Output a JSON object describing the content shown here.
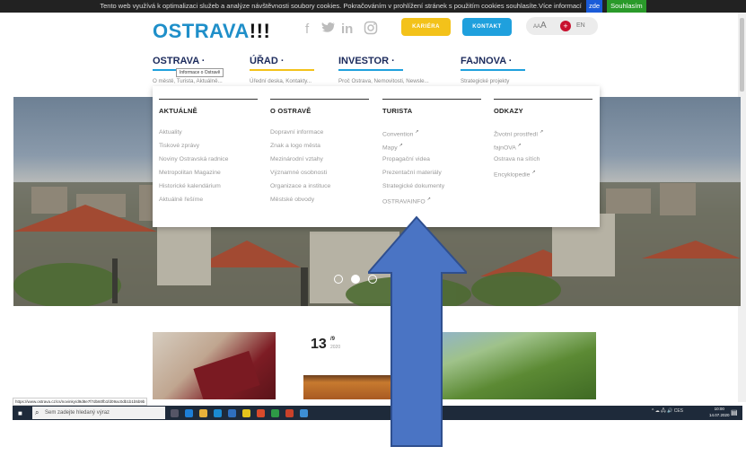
{
  "cookie_bar": {
    "text": "Tento web využívá k optimalizaci služeb a analýze návštěvnosti soubory cookies. Pokračováním v prohlížení stránek s použitím cookies souhlasíte.Více informací",
    "link": "zde",
    "accept": "Souhlasím"
  },
  "header": {
    "logo_main": "OSTRAVA",
    "logo_excl": "!!!",
    "social_icons": [
      "facebook-icon",
      "twitter-icon",
      "linkedin-icon",
      "instagram-icon"
    ],
    "kariera": "KARIÉRA",
    "kontakt": "KONTAKT",
    "font_size_switch": "AA",
    "font_size_small": "A",
    "language": "EN"
  },
  "nav": [
    {
      "title": "OSTRAVA",
      "sub": "O městě, Turista, Aktuálně...",
      "color": "#1fa0dd"
    },
    {
      "title": "ÚŘAD",
      "sub": "Úřední deska, Kontakty...",
      "color": "#f3c21a"
    },
    {
      "title": "INVESTOR",
      "sub": "Proč Ostrava, Nemovitosti, Newsle...",
      "color": "#1fa0dd"
    },
    {
      "title": "FAJNOVA",
      "sub": "Strategické projekty",
      "color": "#1fa0dd"
    }
  ],
  "tooltip": "Informace o Ostravě",
  "mega_menu": {
    "columns": [
      {
        "heading": "AKTUÁLNĚ",
        "links": [
          {
            "label": "Aktuality",
            "ext": false
          },
          {
            "label": "Tiskové zprávy",
            "ext": false
          },
          {
            "label": "Noviny Ostravská radnice",
            "ext": false
          },
          {
            "label": "Metropolitan Magazine",
            "ext": false
          },
          {
            "label": "Historické kalendárium",
            "ext": false
          },
          {
            "label": "Aktuálně řešíme",
            "ext": false
          }
        ]
      },
      {
        "heading": "O OSTRAVĚ",
        "links": [
          {
            "label": "Dopravní informace",
            "ext": false
          },
          {
            "label": "Znak a logo města",
            "ext": false
          },
          {
            "label": "Mezinárodní vztahy",
            "ext": false
          },
          {
            "label": "Významné osobnosti",
            "ext": false
          },
          {
            "label": "Organizace a instituce",
            "ext": false
          },
          {
            "label": "Městské obvody",
            "ext": false
          }
        ]
      },
      {
        "heading": "TURISTA",
        "links": [
          {
            "label": "Convention",
            "ext": true
          },
          {
            "label": "Mapy",
            "ext": true
          },
          {
            "label": "Propagační videa",
            "ext": false
          },
          {
            "label": "Prezentační materiály",
            "ext": false
          },
          {
            "label": "Strategické dokumenty",
            "ext": false
          },
          {
            "label": "OSTRAVAINFO",
            "ext": true
          }
        ]
      },
      {
        "heading": "ODKAZY",
        "links": [
          {
            "label": "Životní prostředí",
            "ext": true
          },
          {
            "label": "fajnOVA",
            "ext": true
          },
          {
            "label": "Ostrava na sítích",
            "ext": false
          },
          {
            "label": "Encyklopedie",
            "ext": true
          }
        ]
      }
    ],
    "ext_mark": "↗"
  },
  "card_date": {
    "day": "13",
    "month": "/9",
    "year": "2020"
  },
  "status_url": "https://www.ostrava.cz/cs/novinky/d9d8e7f7db60fb1fd09ac0db1b1b5b9b",
  "taskbar": {
    "search_placeholder": "Sem zadejte hledaný výraz",
    "tray": "^ ☁ 🖧 🔊 CES",
    "time": "10:00",
    "date": "14.07.2020"
  }
}
